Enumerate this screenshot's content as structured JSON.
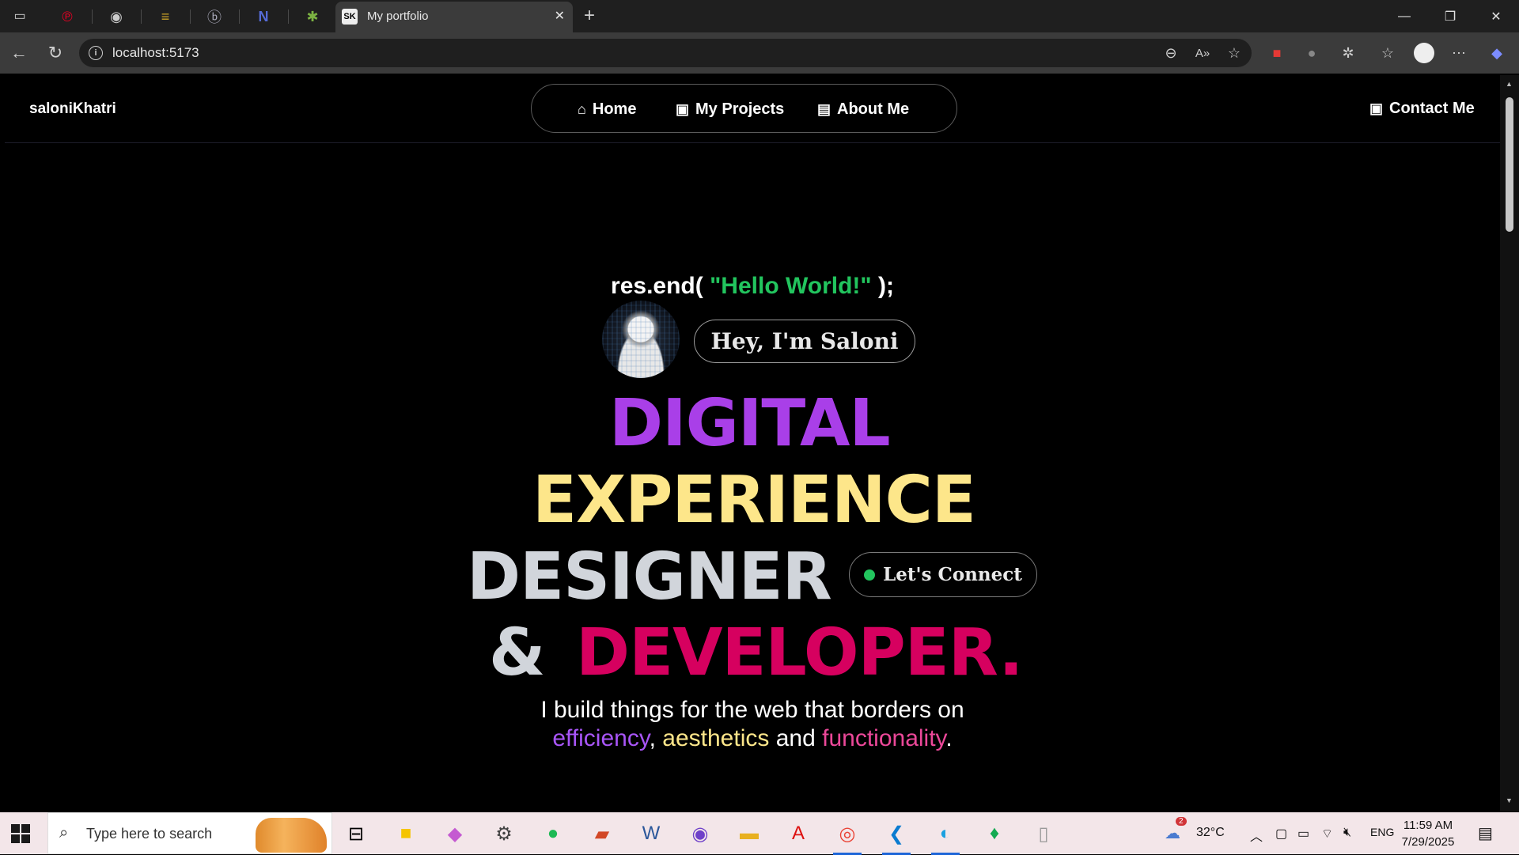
{
  "browser": {
    "pinned_tabs": [
      {
        "name": "pinterest-icon",
        "glyph": "℗",
        "color": "#e60023"
      },
      {
        "name": "github-icon",
        "glyph": "◉",
        "color": "#cccccc"
      },
      {
        "name": "site-icon",
        "glyph": "≡",
        "color": "#c9a227"
      },
      {
        "name": "b-icon",
        "glyph": "ⓑ",
        "color": "#aab"
      },
      {
        "name": "n-icon",
        "glyph": "N",
        "color": "#556bd6"
      },
      {
        "name": "asterisk-icon",
        "glyph": "✱",
        "color": "#7cb342"
      }
    ],
    "active_tab": {
      "title": "My portfolio",
      "favicon": "SK"
    },
    "url": "localhost:5173"
  },
  "site": {
    "brand": "saloniKhatri",
    "nav": [
      {
        "label": "Home",
        "icon": "home-icon",
        "glyph": "🏠︎"
      },
      {
        "label": "My Projects",
        "icon": "briefcase-icon",
        "glyph": "💼︎"
      },
      {
        "label": "About Me",
        "icon": "id-card-icon",
        "glyph": "🪪︎"
      }
    ],
    "contact": {
      "label": "Contact Me",
      "icon": "contact-icon",
      "glyph": "☎"
    }
  },
  "hero": {
    "code_prefix": "res.end( ",
    "code_string": "\"Hello World!\"",
    "code_suffix": " );",
    "greeting": "Hey, I'm Saloni",
    "word_digital": "DIGITAL",
    "word_experience": "EXPERIENCE",
    "word_designer": "DESIGNER",
    "word_amp": "&",
    "word_developer": "DEVELOPER.",
    "connect_label": "Let's Connect",
    "tagline_line1": "I build things for the web that borders on",
    "tag_efficiency": "efficiency",
    "tag_comma": ",",
    "tag_aesthetics": "aesthetics",
    "tag_and": "and",
    "tag_functionality": "functionality",
    "tag_period": ".",
    "colors": {
      "digital": "#a93fe8",
      "experience": "#fde68a",
      "designer": "#d1d5db",
      "developer": "#d6005f",
      "green": "#22c55e"
    }
  },
  "taskbar": {
    "search_placeholder": "Type here to search",
    "weather": "32°C",
    "weather_badge": "2",
    "language": "ENG",
    "time": "11:59 AM",
    "date": "7/29/2025"
  }
}
